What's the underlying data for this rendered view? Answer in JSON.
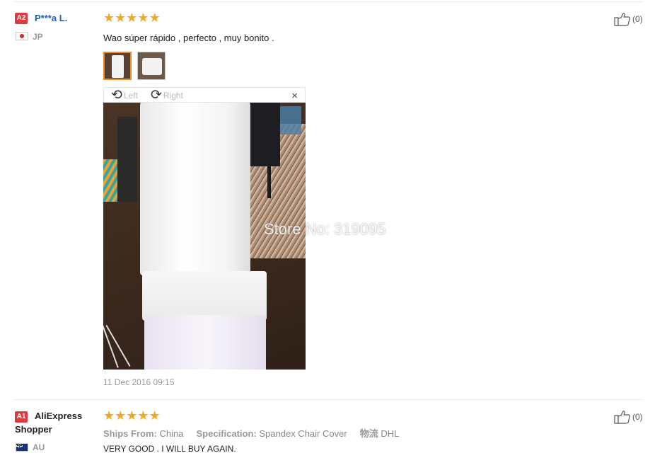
{
  "reviews": [
    {
      "badge": "A2",
      "name": "P***a L.",
      "country": "JP",
      "rating": 5,
      "like_count": "(0)",
      "text": "Wao súper rápido , perfecto , muy bonito .",
      "viewer": {
        "left_label": "Left",
        "right_label": "Right",
        "close": "×"
      },
      "watermark": "Store No: 319095",
      "date": "11 Dec 2016 09:15"
    },
    {
      "badge": "A1",
      "name": "AliExpress Shopper",
      "country": "AU",
      "rating": 5,
      "like_count": "(0)",
      "ships_label": "Ships From:",
      "ships_value": "China",
      "spec_label": "Specification:",
      "spec_value": "Spandex Chair Cover",
      "logistics_label": "物流",
      "logistics_value": "DHL",
      "text": "VERY GOOD . I WILL BUY AGAIN."
    }
  ],
  "colors": {
    "star": "#f5a623",
    "badge": "#e4393c",
    "name": "#1b5fb0",
    "thumb_selected": "#f08a24"
  },
  "icons": {
    "like": "thumbs-up-icon",
    "star": "star-icon",
    "rotate_left": "rotate-left-icon",
    "rotate_right": "rotate-right-icon",
    "close": "close-icon"
  }
}
